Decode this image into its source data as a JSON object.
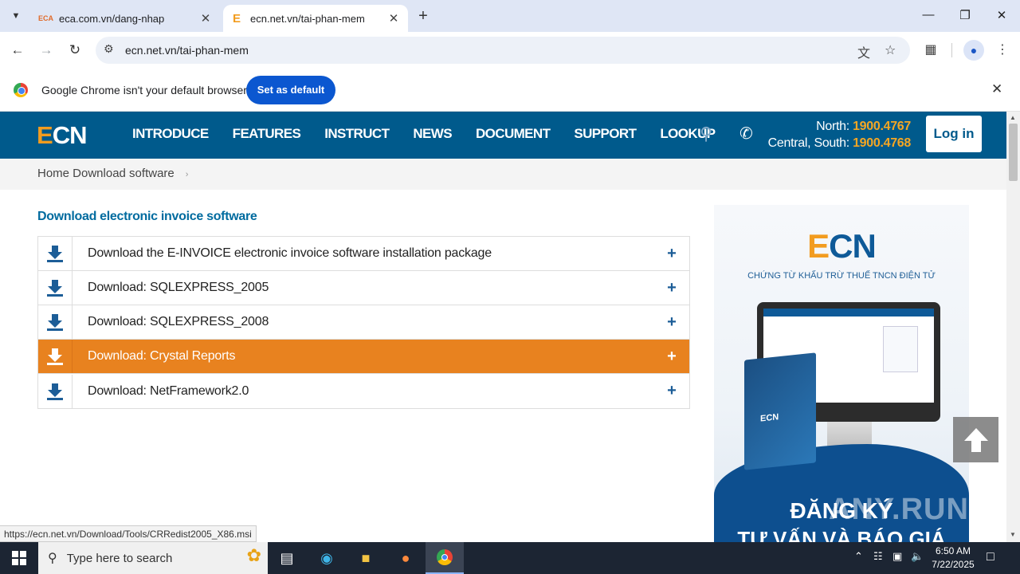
{
  "browser": {
    "tabs": [
      {
        "favicon": "ECA",
        "title": "eca.com.vn/dang-nhap"
      },
      {
        "favicon": "E",
        "title": "ecn.net.vn/tai-phan-mem"
      }
    ],
    "url": "ecn.net.vn/tai-phan-mem",
    "infobar": {
      "message": "Google Chrome isn't your default browser",
      "button": "Set as default"
    },
    "status_url": "https://ecn.net.vn/Download/Tools/CRRedist2005_X86.msi"
  },
  "site": {
    "logo_e": "E",
    "logo_rest": "CN",
    "menu": [
      "INTRODUCE",
      "FEATURES",
      "INSTRUCT",
      "NEWS",
      "DOCUMENT",
      "SUPPORT",
      "LOOKUP"
    ],
    "hotline": {
      "north_label": "North:",
      "north_number": "1900.4767",
      "central_label": "Central, South:",
      "central_number": "1900.4768"
    },
    "login": "Log in"
  },
  "breadcrumb": {
    "text": "Home Download software",
    "sep": "›"
  },
  "content": {
    "section_title": "Download electronic invoice software",
    "downloads": [
      {
        "label": "Download the E-INVOICE electronic invoice software installation package",
        "highlight": false
      },
      {
        "label": "Download: SQLEXPRESS_2005",
        "highlight": false
      },
      {
        "label": "Download: SQLEXPRESS_2008",
        "highlight": false
      },
      {
        "label": "Download: Crystal Reports",
        "highlight": true
      },
      {
        "label": "Download: NetFramework2.0",
        "highlight": false
      }
    ],
    "plus": "+"
  },
  "banner": {
    "logo_e": "E",
    "logo_rest": "CN",
    "subtitle": "CHỨNG TỪ KHẤU TRỪ THUẾ TNCN ĐIỆN TỬ",
    "box_logo": "ECN",
    "cta_line1": "ĐĂNG KÝ",
    "cta_line2": "TƯ VẤN VÀ BÁO GIÁ"
  },
  "watermark": "ANY.RUN",
  "taskbar": {
    "search_placeholder": "Type here to search",
    "time": "6:50 AM",
    "date": "7/22/2025"
  },
  "colors": {
    "header_blue": "#005a8c",
    "accent_orange": "#e8821f",
    "logo_orange": "#f29c1f",
    "chrome_blue": "#0b57d0"
  }
}
